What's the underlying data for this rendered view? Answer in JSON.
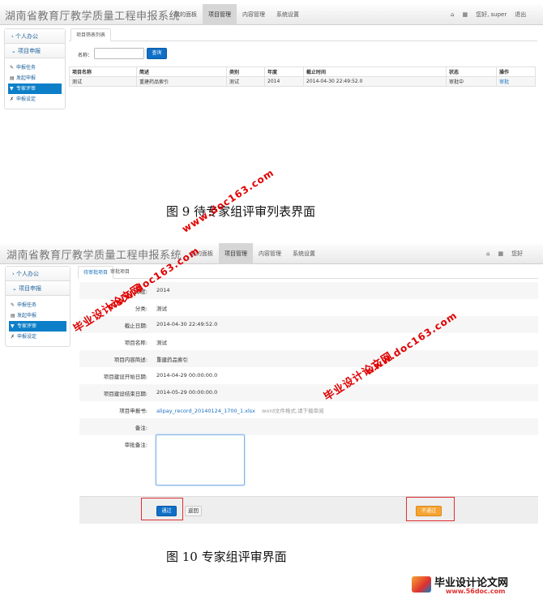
{
  "screen1": {
    "app_title": "湖南省教育厅教学质量工程申报系统",
    "nav": [
      "我的面板",
      "项目管理",
      "内容管理",
      "系统设置"
    ],
    "nav_active": "项目管理",
    "user_greeting": "您好, super",
    "logout": "退出",
    "sidebar": {
      "group1": "个人办公",
      "group2": "项目申报",
      "items": [
        "申报任务",
        "发起申报",
        "专家评审",
        "申报设定"
      ],
      "active_item": "专家评审"
    },
    "tab": "项目筛表列表",
    "search": {
      "label": "名称：",
      "value": "",
      "button": "查询"
    },
    "table": {
      "headers": [
        "项目名称",
        "简述",
        "类别",
        "年度",
        "截止时间",
        "状态",
        "操作"
      ],
      "rows": [
        [
          "测试",
          "重建药品索引",
          "测试",
          "2014",
          "2014-04-30 22:49:52.0",
          "审批中",
          "审批"
        ]
      ]
    }
  },
  "caption1": "图 9  待专家组评审列表界面",
  "screen2": {
    "app_title": "湖南省教育厅教学质量工程申报系统",
    "nav": [
      "我的面板",
      "项目管理",
      "内容管理",
      "系统设置"
    ],
    "nav_active": "项目管理",
    "user_greeting": "您好",
    "sidebar": {
      "group1": "个人办公",
      "group2": "项目申报",
      "items": [
        "申报任务",
        "发起申报",
        "专家评审",
        "申报设定"
      ],
      "active_item": "专家评审"
    },
    "tab": "待审批项目",
    "tab_overlap_text": "审批项目",
    "form": [
      {
        "label": "年度:",
        "value": "2014"
      },
      {
        "label": "分类:",
        "value": "测试"
      },
      {
        "label": "截止日期:",
        "value": "2014-04-30 22:49:52.0"
      },
      {
        "label": "项目名称:",
        "value": "测试"
      },
      {
        "label": "项目内容简述:",
        "value": "重建药品索引"
      },
      {
        "label": "项目建设开始日期:",
        "value": "2014-04-29 00:00:00.0"
      },
      {
        "label": "项目建设结束日期:",
        "value": "2014-05-29 00:00:00.0"
      },
      {
        "label": "项目申报书:",
        "value": "alipay_record_20140124_1700_1.xlsx",
        "hint": "word文件格式,请下载审阅"
      },
      {
        "label": "备注:",
        "value": ""
      }
    ],
    "review_label": "审批备注:",
    "review_value": "",
    "buttons": {
      "pass": "通过",
      "back": "返回",
      "reject": "不通过"
    }
  },
  "caption2": "图 10 专家组评审界面",
  "watermarks": [
    "毕业设计论文网",
    "www.doc163.com"
  ],
  "footer_logo": {
    "text": "毕业设计论文网",
    "url": "www.56doc.com"
  },
  "colors": {
    "accent": "#0f6fc6",
    "active_item": "#0c7fc8",
    "warning": "#f6a534",
    "watermark": "#e00000"
  }
}
